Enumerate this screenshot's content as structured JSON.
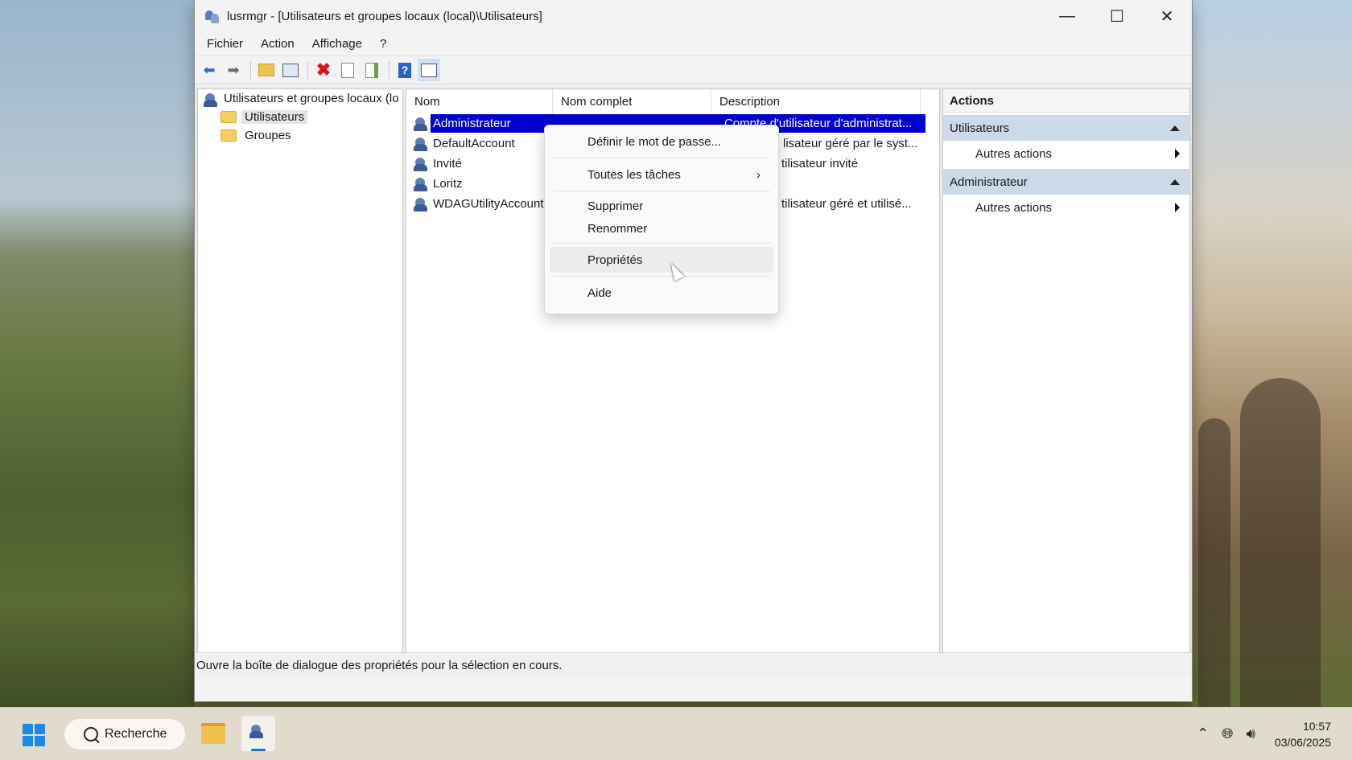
{
  "window": {
    "title": "lusrmgr - [Utilisateurs et groupes locaux (local)\\Utilisateurs]",
    "controls": {
      "minimize": "—",
      "maximize": "☐",
      "close": "✕"
    }
  },
  "menubar": [
    "Fichier",
    "Action",
    "Affichage",
    "?"
  ],
  "toolbar": [
    "back-icon",
    "forward-icon",
    "up-folder-icon",
    "show-hide-tree-icon",
    "delete-icon",
    "properties-icon",
    "export-icon",
    "help-icon",
    "show-hide-action-pane-icon"
  ],
  "tree": {
    "root": "Utilisateurs et groupes locaux (lo",
    "children": [
      "Utilisateurs",
      "Groupes"
    ]
  },
  "list": {
    "columns": [
      "Nom",
      "Nom complet",
      "Description"
    ],
    "rows": [
      {
        "name": "Administrateur",
        "full_name": "",
        "description": "Compte d'utilisateur d'administrat..."
      },
      {
        "name": "DefaultAccount",
        "full_name": "",
        "description": "lisateur géré par le syst..."
      },
      {
        "name": "Invité",
        "full_name": "",
        "description": "tilisateur invité"
      },
      {
        "name": "Loritz",
        "full_name": "",
        "description": ""
      },
      {
        "name": "WDAGUtilityAccount",
        "full_name": "",
        "description": "tilisateur géré et utilisé..."
      }
    ]
  },
  "actions": {
    "title": "Actions",
    "groups": [
      {
        "label": "Utilisateurs",
        "item": "Autres actions"
      },
      {
        "label": "Administrateur",
        "item": "Autres actions"
      }
    ]
  },
  "context_menu": {
    "items": [
      "Définir le mot de passe...",
      "Toutes les tâches",
      "Supprimer",
      "Renommer",
      "Propriétés",
      "Aide"
    ]
  },
  "statusbar": "Ouvre la boîte de dialogue des propriétés pour la sélection en cours.",
  "taskbar": {
    "search_label": "Recherche",
    "time": "10:57",
    "date": "03/06/2025"
  },
  "colors": {
    "selection": "#0000d0",
    "action_group": "#cbd9e8",
    "start_blue": "#1c88e8"
  }
}
